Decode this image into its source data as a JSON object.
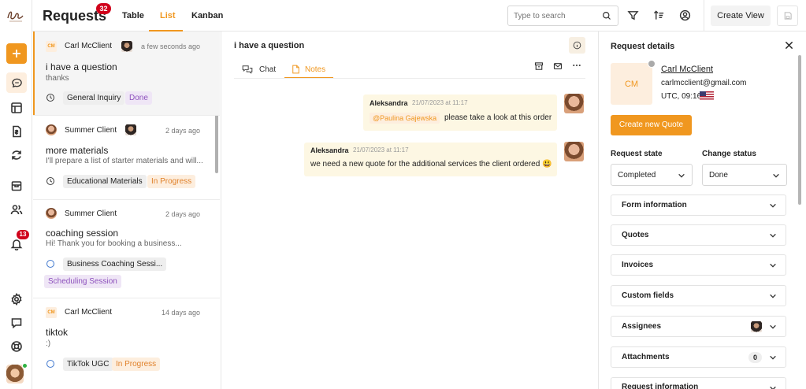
{
  "header": {
    "title": "Requests",
    "badge": "32",
    "tabs": [
      "Table",
      "List",
      "Kanban"
    ],
    "active_tab": "List",
    "search_placeholder": "Type to search",
    "create_view": "Create View"
  },
  "rail": {
    "notif_badge": "13"
  },
  "list": [
    {
      "client": "Carl McClient",
      "initials": "CM",
      "time": "a few seconds ago",
      "title": "i have a question",
      "snippet": "thanks",
      "tags": [
        {
          "label": "General Inquiry",
          "kind": "grey"
        },
        {
          "label": "Done",
          "kind": "done"
        }
      ]
    },
    {
      "client": "Summer Client",
      "time": "2 days ago",
      "title": "more materials",
      "snippet": "I'll prepare a list of starter materials and will...",
      "tags": [
        {
          "label": "Educational Materials",
          "kind": "grey"
        },
        {
          "label": "In Progress",
          "kind": "prog"
        }
      ]
    },
    {
      "client": "Summer Client",
      "time": "2 days ago",
      "title": "coaching session",
      "snippet": "Hi! Thank you for booking a business...",
      "tags": [
        {
          "label": "Business Coaching Sessi...",
          "kind": "grey"
        },
        {
          "label": "Scheduling Session",
          "kind": "sched"
        }
      ]
    },
    {
      "client": "Carl McClient",
      "initials": "CM",
      "time": "14 days ago",
      "title": "tiktok",
      "snippet": ":)",
      "tags": [
        {
          "label": "TikTok UGC",
          "kind": "grey"
        },
        {
          "label": "In Progress",
          "kind": "prog"
        }
      ]
    }
  ],
  "conversation": {
    "title": "i have a question",
    "tabs": [
      "Chat",
      "Notes"
    ],
    "active_tab": "Notes",
    "messages": [
      {
        "author": "Aleksandra",
        "time": "21/07/2023 at 11:17",
        "mention": "@Paulina Gajewska",
        "text": "please take a look at this order"
      },
      {
        "author": "Aleksandra",
        "time": "21/07/2023 at 11:17",
        "mention": "",
        "text": "we need a new quote for the additional services the client ordered 😃"
      }
    ]
  },
  "details": {
    "title": "Request details",
    "client_name": "Carl McClient",
    "initials": "CM",
    "email": "carlmcclient@gmail.com",
    "timezone": "UTC, 09:16",
    "create_quote": "Create new Quote",
    "request_state_label": "Request state",
    "request_state": "Completed",
    "change_status_label": "Change status",
    "change_status": "Done",
    "sections": [
      "Form information",
      "Quotes",
      "Invoices",
      "Custom fields",
      "Assignees",
      "Attachments",
      "Request information"
    ],
    "attachments_count": "0"
  },
  "colors": {
    "accent": "#f0971f",
    "badge": "#d0021b"
  }
}
